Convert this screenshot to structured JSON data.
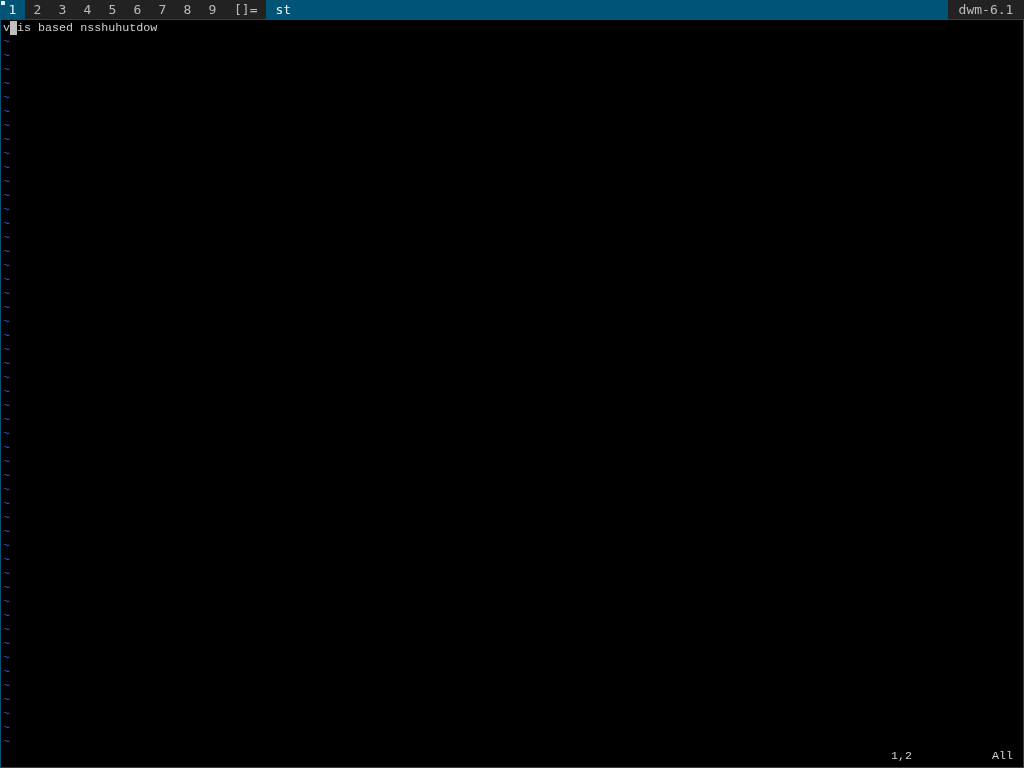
{
  "bar": {
    "tags": [
      {
        "label": "1",
        "selected": true,
        "occupied": true
      },
      {
        "label": "2",
        "selected": false,
        "occupied": false
      },
      {
        "label": "3",
        "selected": false,
        "occupied": false
      },
      {
        "label": "4",
        "selected": false,
        "occupied": false
      },
      {
        "label": "5",
        "selected": false,
        "occupied": false
      },
      {
        "label": "6",
        "selected": false,
        "occupied": false
      },
      {
        "label": "7",
        "selected": false,
        "occupied": false
      },
      {
        "label": "8",
        "selected": false,
        "occupied": false
      },
      {
        "label": "9",
        "selected": false,
        "occupied": false
      }
    ],
    "layout": "[]=",
    "title": "st",
    "status": "dwm-6.1"
  },
  "editor": {
    "line": {
      "before": "v",
      "after": "is based nsshuhutdow"
    },
    "empty_lines": [
      "~",
      "~",
      "~",
      "~",
      "~",
      "~",
      "~",
      "~",
      "~",
      "~",
      "~",
      "~",
      "~",
      "~",
      "~",
      "~",
      "~",
      "~",
      "~",
      "~",
      "~",
      "~",
      "~",
      "~",
      "~",
      "~",
      "~",
      "~",
      "~",
      "~",
      "~",
      "~",
      "~",
      "~",
      "~",
      "~",
      "~",
      "~",
      "~",
      "~",
      "~",
      "~",
      "~",
      "~",
      "~",
      "~",
      "~",
      "~",
      "~",
      "~",
      "~"
    ],
    "ruler": "1,2",
    "position": "All"
  }
}
